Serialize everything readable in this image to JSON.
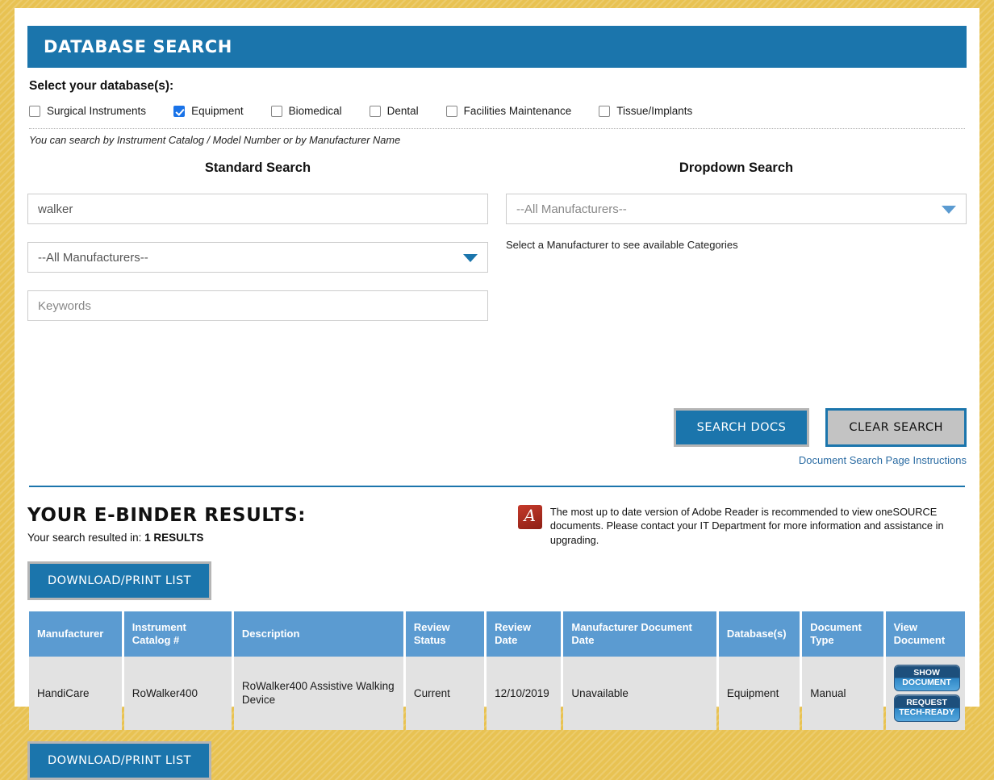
{
  "header": {
    "title": "DATABASE SEARCH"
  },
  "database_selector": {
    "label": "Select your database(s):",
    "options": [
      {
        "label": "Surgical Instruments",
        "checked": false
      },
      {
        "label": "Equipment",
        "checked": true
      },
      {
        "label": "Biomedical",
        "checked": false
      },
      {
        "label": "Dental",
        "checked": false
      },
      {
        "label": "Facilities Maintenance",
        "checked": false
      },
      {
        "label": "Tissue/Implants",
        "checked": false
      }
    ],
    "hint": "You can search by Instrument Catalog / Model Number or by Manufacturer Name"
  },
  "standard_search": {
    "heading": "Standard Search",
    "query_value": "walker",
    "manufacturer_value": "--All Manufacturers--",
    "keywords_placeholder": "Keywords"
  },
  "dropdown_search": {
    "heading": "Dropdown Search",
    "manufacturer_value": "--All Manufacturers--",
    "note": "Select a Manufacturer to see available Categories"
  },
  "actions": {
    "search_label": "SEARCH DOCS",
    "clear_label": "CLEAR SEARCH",
    "instructions_link": "Document Search Page Instructions"
  },
  "results": {
    "heading": "YOUR E-BINDER RESULTS:",
    "count_prefix": "Your search resulted in:",
    "count_value": "1 RESULTS",
    "download_label_top": "DOWNLOAD/PRINT LIST",
    "download_label_bottom": "DOWNLOAD/PRINT LIST",
    "adobe_notice": "The most up to date version of Adobe Reader is recommended to view oneSOURCE documents. Please contact your IT Department for more information and assistance in upgrading.",
    "columns": [
      "Manufacturer",
      "Instrument Catalog #",
      "Description",
      "Review Status",
      "Review Date",
      "Manufacturer Document Date",
      "Database(s)",
      "Document Type",
      "View Document"
    ],
    "row": {
      "manufacturer": "HandiCare",
      "catalog": "RoWalker400",
      "description": "RoWalker400 Assistive Walking Device",
      "review_status": "Current",
      "review_date": "12/10/2019",
      "manufacturer_document_date": "Unavailable",
      "databases": "Equipment",
      "document_type": "Manual",
      "show_document_label": "SHOW DOCUMENT",
      "request_tech_ready_label": "REQUEST TECH-READY"
    }
  },
  "colors": {
    "brand_blue": "#1b75ac",
    "table_header_blue": "#5b9bd1",
    "page_background_gold": "#e8c252",
    "row_gray": "#e2e2e2",
    "link_blue": "#2b6ca3"
  }
}
